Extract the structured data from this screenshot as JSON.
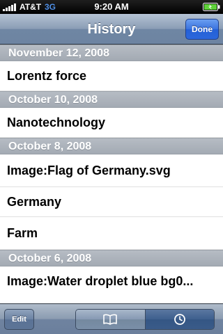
{
  "status_bar": {
    "carrier": "AT&T",
    "network": "3G",
    "time": "9:20 AM",
    "signal_icon": "signal-bars-icon",
    "battery_icon": "battery-charging-icon"
  },
  "nav": {
    "title": "History",
    "done_label": "Done"
  },
  "history": {
    "sections": [
      {
        "date": "November 12, 2008",
        "items": [
          "Lorentz force"
        ]
      },
      {
        "date": "October 10, 2008",
        "items": [
          "Nanotechnology"
        ]
      },
      {
        "date": "October 8, 2008",
        "items": [
          "Image:Flag of Germany.svg",
          "Germany",
          "Farm"
        ]
      },
      {
        "date": "October 6, 2008",
        "items": [
          "Image:Water droplet blue bg0..."
        ]
      }
    ]
  },
  "toolbar": {
    "edit_label": "Edit",
    "segments": [
      {
        "icon": "book-icon",
        "selected": false
      },
      {
        "icon": "clock-icon",
        "selected": true
      }
    ]
  },
  "colors": {
    "network_3g": "#4f8fe6",
    "done_button": "#2b67dc",
    "section_header": "#a9b0b9",
    "nav_bar": "#6d84a2"
  }
}
